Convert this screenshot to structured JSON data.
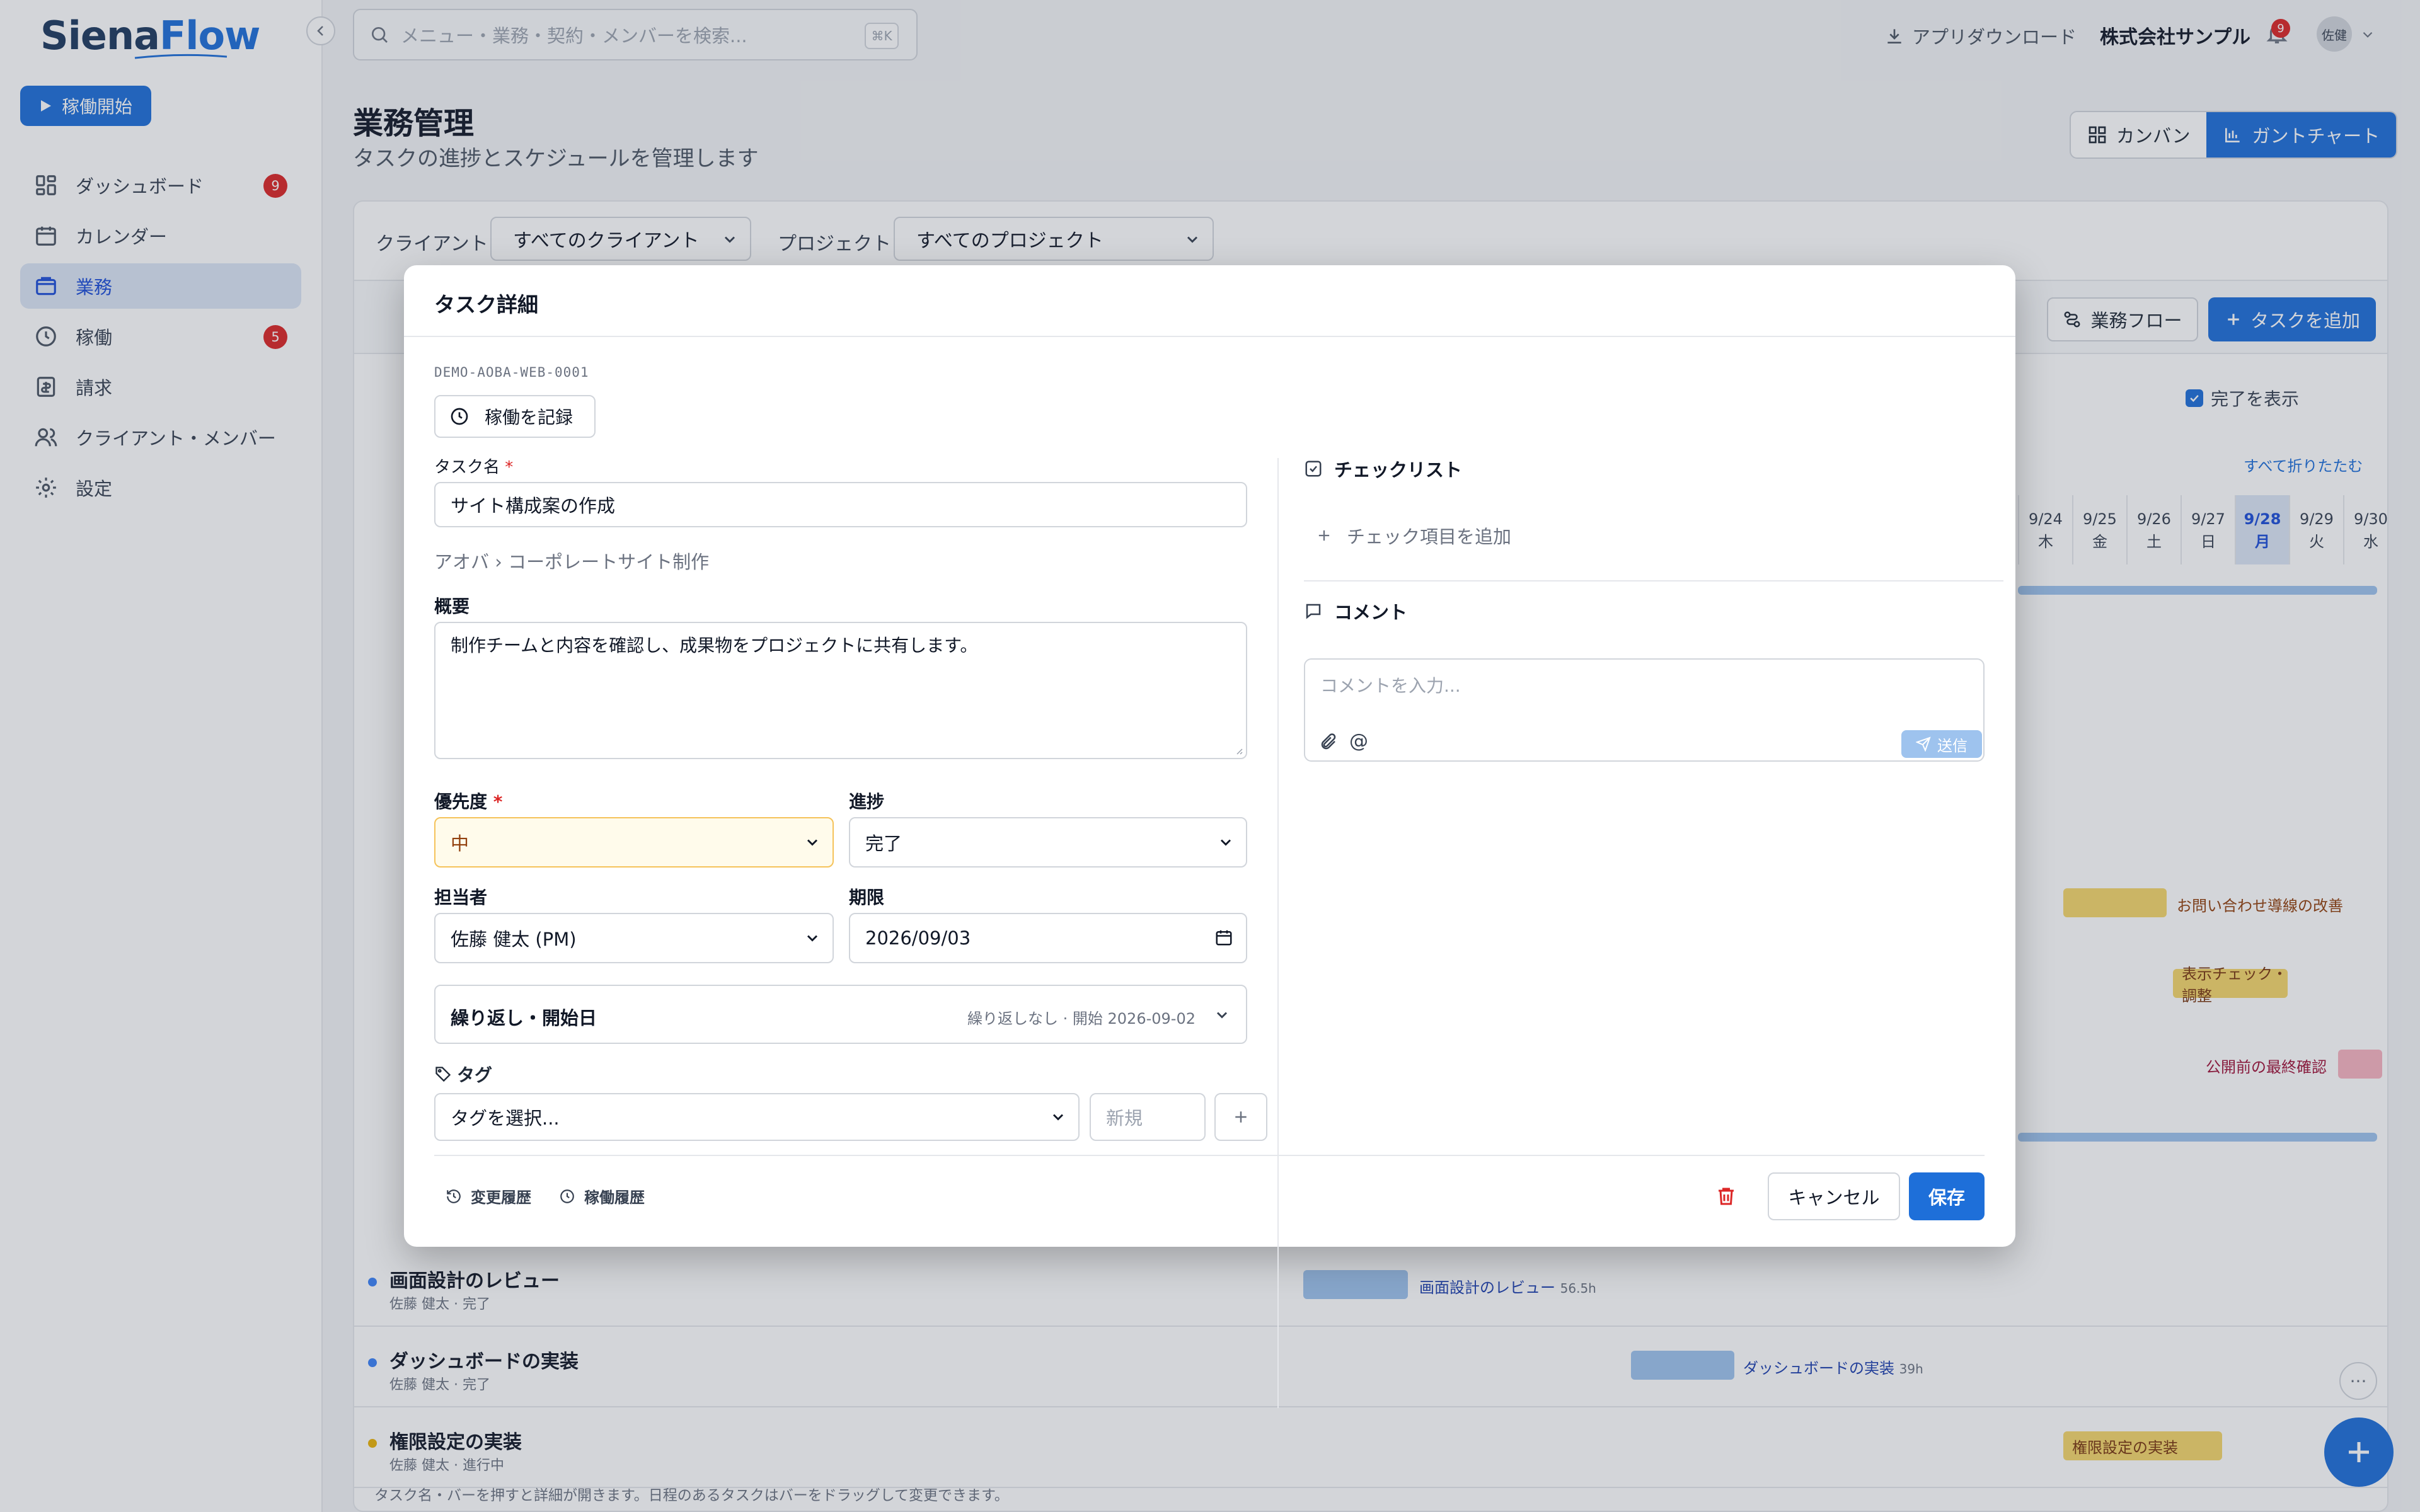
{
  "app": {
    "logo_main": "Siena",
    "logo_accent": "Flow"
  },
  "sidebar": {
    "start_label": "稼働開始",
    "items": [
      {
        "label": "ダッシュボード",
        "badge": "9",
        "icon": "grid-icon"
      },
      {
        "label": "カレンダー",
        "badge": "",
        "icon": "calendar-icon"
      },
      {
        "label": "業務",
        "badge": "",
        "icon": "briefcase-icon",
        "active": true
      },
      {
        "label": "稼働",
        "badge": "5",
        "icon": "clock-icon"
      },
      {
        "label": "請求",
        "badge": "",
        "icon": "invoice-icon"
      },
      {
        "label": "クライアント・メンバー",
        "badge": "",
        "icon": "users-icon"
      },
      {
        "label": "設定",
        "badge": "",
        "icon": "gear-icon"
      }
    ]
  },
  "header": {
    "search_placeholder": "メニュー・業務・契約・メンバーを検索...",
    "search_shortcut": "⌘K",
    "download_label": "アプリダウンロード",
    "company": "株式会社サンプル",
    "notification_count": "9",
    "avatar_initials": "佐健"
  },
  "main": {
    "title": "業務管理",
    "subtitle": "タスクの進捗とスケジュールを管理します",
    "view_kanban": "カンバン",
    "view_gantt": "ガントチャート",
    "filter_client_label": "クライアント",
    "filter_client_value": "すべてのクライアント",
    "filter_project_label": "プロジェクト",
    "filter_project_value": "すべてのプロジェクト",
    "flow_button": "業務フロー",
    "add_task_button": "タスクを追加",
    "show_done": "完了を表示",
    "collapse_all": "すべて折りたたむ",
    "days": [
      {
        "date": "9/24",
        "dow": "木"
      },
      {
        "date": "9/25",
        "dow": "金"
      },
      {
        "date": "9/26",
        "dow": "土"
      },
      {
        "date": "9/27",
        "dow": "日"
      },
      {
        "date": "9/28",
        "dow": "月",
        "today": true
      },
      {
        "date": "9/29",
        "dow": "火"
      },
      {
        "date": "9/30",
        "dow": "水"
      }
    ],
    "bar_labels": {
      "inquiry": "お問い合わせ導線の改善",
      "display_check": "表示チェック・調整",
      "final_check": "公開前の最終確認"
    },
    "rows": [
      {
        "name": "画面設計のレビュー",
        "meta": "佐藤 健太 · 完了",
        "bar_label": "画面設計のレビュー",
        "hours": "56.5h"
      },
      {
        "name": "ダッシュボードの実装",
        "meta": "佐藤 健太 · 完了",
        "bar_label": "ダッシュボードの実装",
        "hours": "39h"
      },
      {
        "name": "権限設定の実装",
        "meta": "佐藤 健太 · 進行中",
        "bar_label": "権限設定の実装",
        "hours": ""
      }
    ],
    "footer_note": "タスク名・バーを押すと詳細が開きます。日程のあるタスクはバーをドラッグして変更できます。",
    "more_label": "···"
  },
  "modal": {
    "title": "タスク詳細",
    "task_id": "DEMO-AOBA-WEB-0001",
    "record_button": "稼働を記録",
    "task_name_label": "タスク名",
    "required_mark": "*",
    "task_name_value": "サイト構成案の作成",
    "breadcrumb_client": "アオバ",
    "breadcrumb_sep": "›",
    "breadcrumb_project": "コーポレートサイト制作",
    "summary_label": "概要",
    "summary_value": "制作チームと内容を確認し、成果物をプロジェクトに共有します。",
    "priority_label": "優先度",
    "priority_value": "中",
    "progress_label": "進捗",
    "progress_value": "完了",
    "assignee_label": "担当者",
    "assignee_value": "佐藤 健太 (PM)",
    "due_label": "期限",
    "due_value": "2026/09/03",
    "repeat_label": "繰り返し・開始日",
    "repeat_summary": "繰り返しなし · 開始 2026-09-02",
    "tags_label": "タグ",
    "tags_placeholder": "タグを選択...",
    "new_tag_placeholder": "新規",
    "checklist_label": "チェックリスト",
    "add_check_item": "チェック項目を追加",
    "comment_label": "コメント",
    "comment_placeholder": "コメントを入力...",
    "send_label": "送信",
    "history_label": "変更履歴",
    "work_history_label": "稼働履歴",
    "cancel_label": "キャンセル",
    "save_label": "保存"
  },
  "colors": {
    "accent": "#1e6fd9",
    "danger": "#dc2626",
    "priority_border": "#f5c35a"
  }
}
